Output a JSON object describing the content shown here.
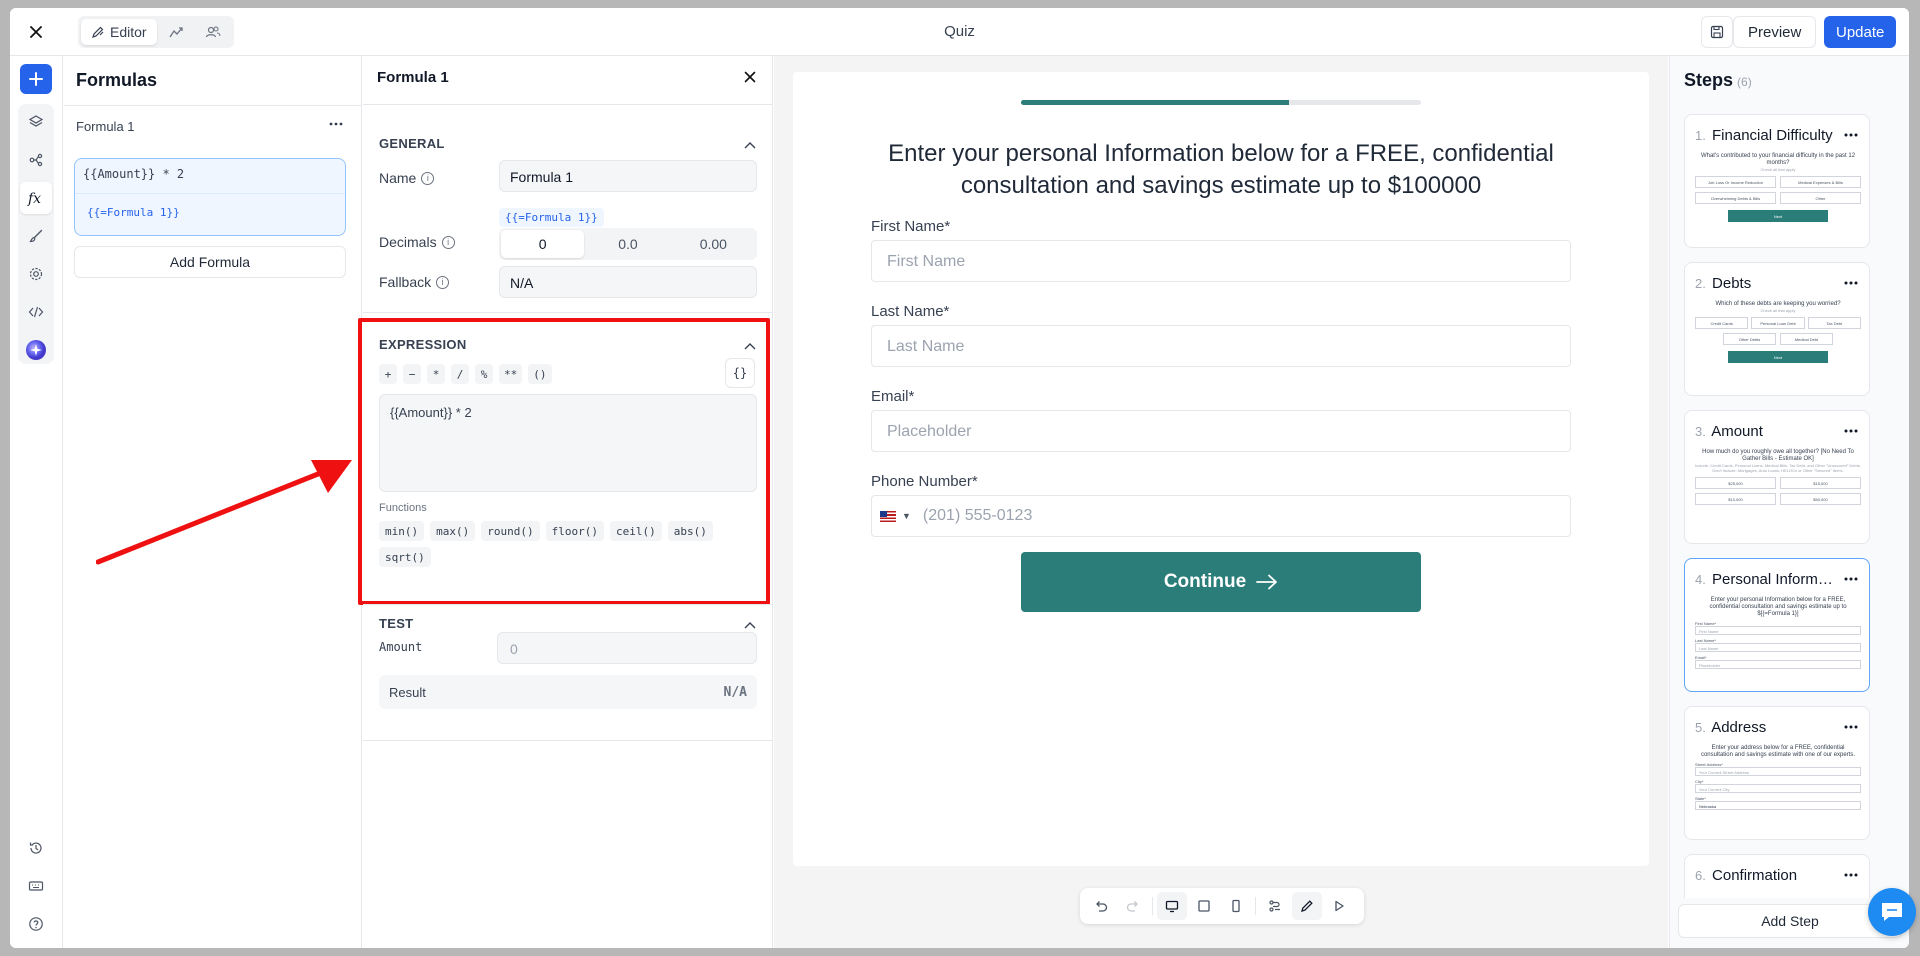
{
  "topbar": {
    "tabs": [
      {
        "label": "Editor",
        "icon": "pencil-ruler-icon"
      },
      {
        "label": "",
        "icon": "chart-icon"
      },
      {
        "label": "",
        "icon": "users-icon"
      }
    ],
    "title": "Quiz",
    "preview_label": "Preview",
    "update_label": "Update"
  },
  "formulas": {
    "title": "Formulas",
    "item_name": "Formula 1",
    "item_code": "{{Amount}} * 2",
    "item_ref": "{{=Formula 1}}",
    "add_label": "Add Formula"
  },
  "detail": {
    "title": "Formula 1",
    "general": {
      "title": "GENERAL",
      "name_label": "Name",
      "name_value": "Formula 1",
      "name_ref": "{{=Formula 1}}",
      "decimals_label": "Decimals",
      "decimals_options": [
        "0",
        "0.0",
        "0.00"
      ],
      "fallback_label": "Fallback",
      "fallback_value": "N/A"
    },
    "expression": {
      "title": "EXPRESSION",
      "operators": [
        "+",
        "−",
        "*",
        "/",
        "%",
        "**",
        "()"
      ],
      "braces": "{}",
      "value": "{{Amount}} * 2",
      "functions_label": "Functions",
      "functions": [
        "min()",
        "max()",
        "round()",
        "floor()",
        "ceil()",
        "abs()",
        "sqrt()"
      ]
    },
    "test": {
      "title": "TEST",
      "amount_label": "Amount",
      "amount_placeholder": "0",
      "result_label": "Result",
      "result_value": "N/A"
    }
  },
  "canvas": {
    "progress": 0.67,
    "title": "Enter your personal Information below for a FREE, confidential consultation and savings estimate up to $100000",
    "fields": [
      {
        "label": "First Name*",
        "placeholder": "First Name"
      },
      {
        "label": "Last Name*",
        "placeholder": "Last Name"
      },
      {
        "label": "Email*",
        "placeholder": "Placeholder"
      },
      {
        "label": "Phone Number*",
        "placeholder": "(201) 555-0123"
      }
    ],
    "continue_label": "Continue"
  },
  "steps": {
    "title": "Steps",
    "count": "(6)",
    "items": [
      {
        "num": "1.",
        "name": "Financial Difficulty",
        "preview_title": "What's contributed to your financial difficulty in the past 12 months?",
        "preview_sub": "Check all that apply",
        "options": [
          "Job Loss Or Income Reduction",
          "Medical Expenses & Bills",
          "Overwhelming Debts & Bills",
          "Other"
        ],
        "button": "Next"
      },
      {
        "num": "2.",
        "name": "Debts",
        "preview_title": "Which of these debts are keeping you worried?",
        "preview_sub": "Check all that apply",
        "options": [
          "Credit Cards",
          "Personal Loan Debt",
          "Tax Debt",
          "Other Debts",
          "Medical Debt"
        ],
        "button": "Next"
      },
      {
        "num": "3.",
        "name": "Amount",
        "preview_title": "How much do you roughly owe all together? [No Need To Gather Bills - Estimate OK]",
        "preview_sub": "Include: Credit Cards, Personal Loans, Medical Bills, Tax Debt, and Other \"Unsecured\" Debts. Don't Include: Mortgages, Auto Loans, HELOCs or Other \"Secured\" Items.",
        "options": [
          "$25,000",
          "$15,000",
          "$10,000",
          "$50,000"
        ],
        "button": ""
      },
      {
        "num": "4.",
        "name": "Personal Informati...",
        "preview_title": "Enter your personal Information below for a FREE, confidential consultation and savings estimate up to $[{=Formula 1}]",
        "fields": [
          {
            "label": "First Name*",
            "placeholder": "First Name"
          },
          {
            "label": "Last Name*",
            "placeholder": "Last Name"
          },
          {
            "label": "Email*",
            "placeholder": "Placeholder"
          }
        ]
      },
      {
        "num": "5.",
        "name": "Address",
        "preview_title": "Enter your address below for a FREE, confidential consultation and savings estimate with one of our experts.",
        "fields": [
          {
            "label": "Street Address*",
            "placeholder": "Your Current Street Address"
          },
          {
            "label": "City*",
            "placeholder": "Your Current City"
          },
          {
            "label": "State*",
            "placeholder": "Nebraska"
          }
        ]
      },
      {
        "num": "6.",
        "name": "Confirmation"
      }
    ],
    "add_label": "Add Step"
  },
  "colors": {
    "accent": "#2563eb",
    "brand": "#2a7d78",
    "highlight": "#ef1111"
  }
}
